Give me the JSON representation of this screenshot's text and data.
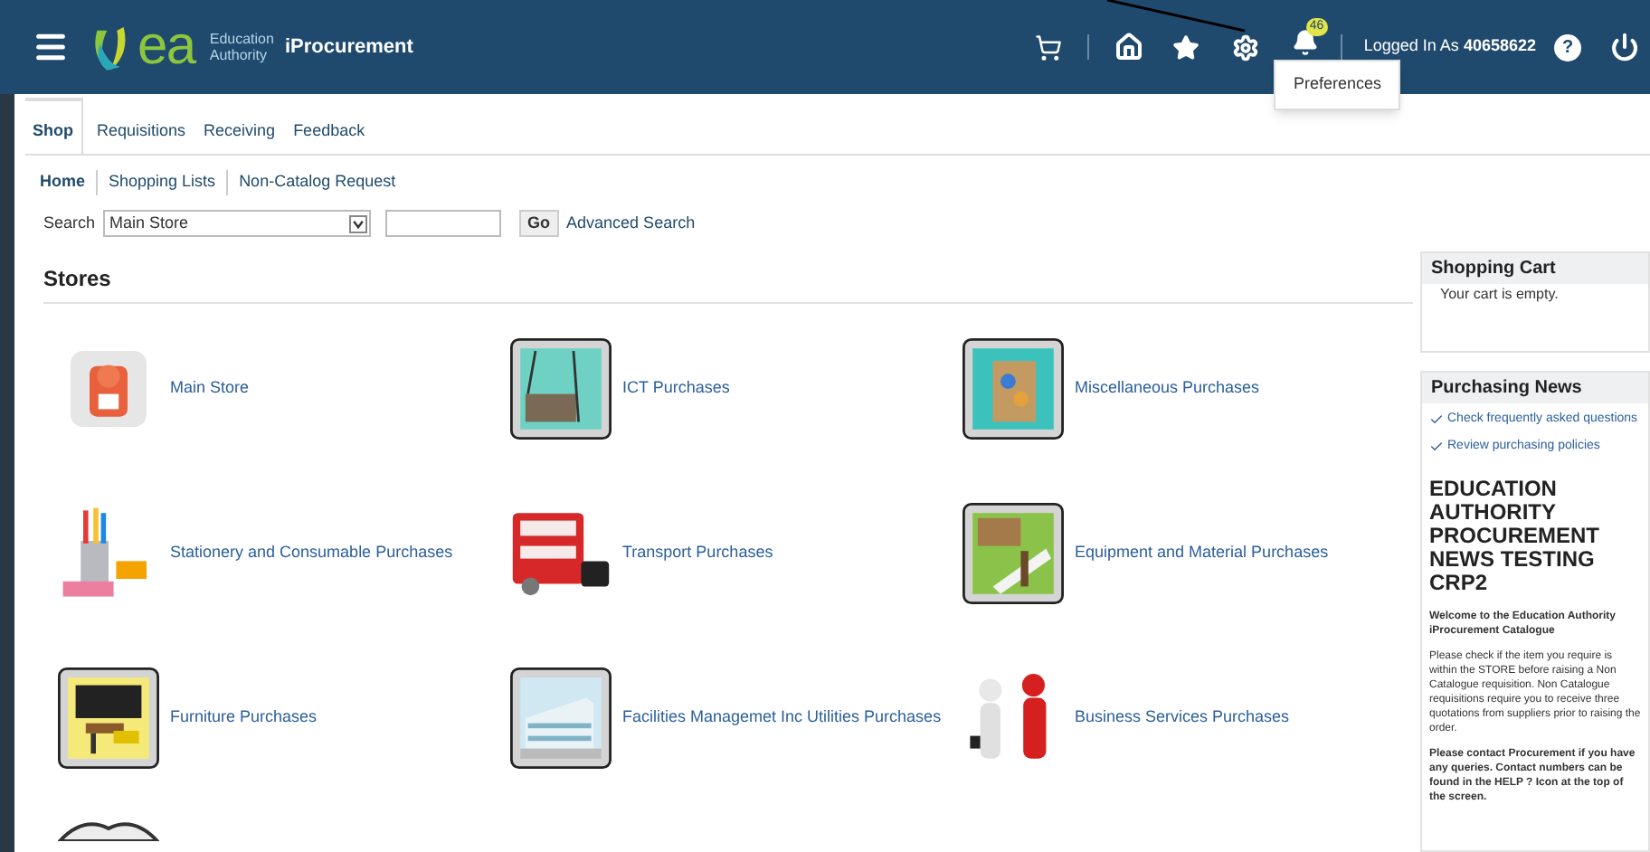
{
  "header": {
    "logo_letters": "ea",
    "logo_org": [
      "Education",
      "Authority"
    ],
    "app_name": "iProcurement",
    "notification_count": "46",
    "logged_in_label": "Logged In As",
    "user_id": "40658622",
    "help": "?"
  },
  "menu": {
    "items": [
      "Preferences"
    ]
  },
  "tabs": [
    {
      "label": "Shop",
      "selected": true
    },
    {
      "label": "Requisitions",
      "selected": false
    },
    {
      "label": "Receiving",
      "selected": false
    },
    {
      "label": "Feedback",
      "selected": false
    }
  ],
  "subnav": [
    {
      "label": "Home",
      "selected": true
    },
    {
      "label": "Shopping Lists",
      "selected": false
    },
    {
      "label": "Non-Catalog Request",
      "selected": false
    }
  ],
  "search": {
    "label": "Search",
    "scope": "Main Store",
    "go": "Go",
    "advanced": "Advanced Search"
  },
  "stores_title": "Stores",
  "stores": [
    {
      "kind": "store",
      "name": "Main Store"
    },
    {
      "kind": "store",
      "name": "ICT Purchases"
    },
    {
      "kind": "store",
      "name": "Miscellaneous Purchases"
    },
    {
      "kind": "store",
      "name": "Stationery and Consumable Purchases"
    },
    {
      "kind": "store",
      "name": "Transport Purchases"
    },
    {
      "kind": "store",
      "name": "Equipment and Material Purchases"
    },
    {
      "kind": "store",
      "name": "Furniture Purchases"
    },
    {
      "kind": "store",
      "name": "Facilities Managemet Inc Utilities Purchases"
    },
    {
      "kind": "store",
      "name": "Business Services Purchases"
    },
    {
      "kind": "picture"
    }
  ],
  "cart": {
    "title": "Shopping Cart",
    "text": "Your cart is empty."
  },
  "news": {
    "title": "Purchasing News",
    "links": [
      "Check frequently asked questions",
      "Review purchasing policies"
    ],
    "headline": "EDUCATION AUTHORITY PROCUREMENT NEWS TESTING CRP2",
    "welcome": "Welcome to the Education Authority iProcurement Catalogue",
    "paragraphs": [
      "Please check if the item you require is within the STORE before raising a Non Catalogue requisition. Non Catalogue requisitions require you to receive three quotations from suppliers prior to raising the order.",
      "**Please contact Procurement if you have any queries. Contact numbers can be found in the HELP ? Icon at the top of the screen.**"
    ]
  }
}
